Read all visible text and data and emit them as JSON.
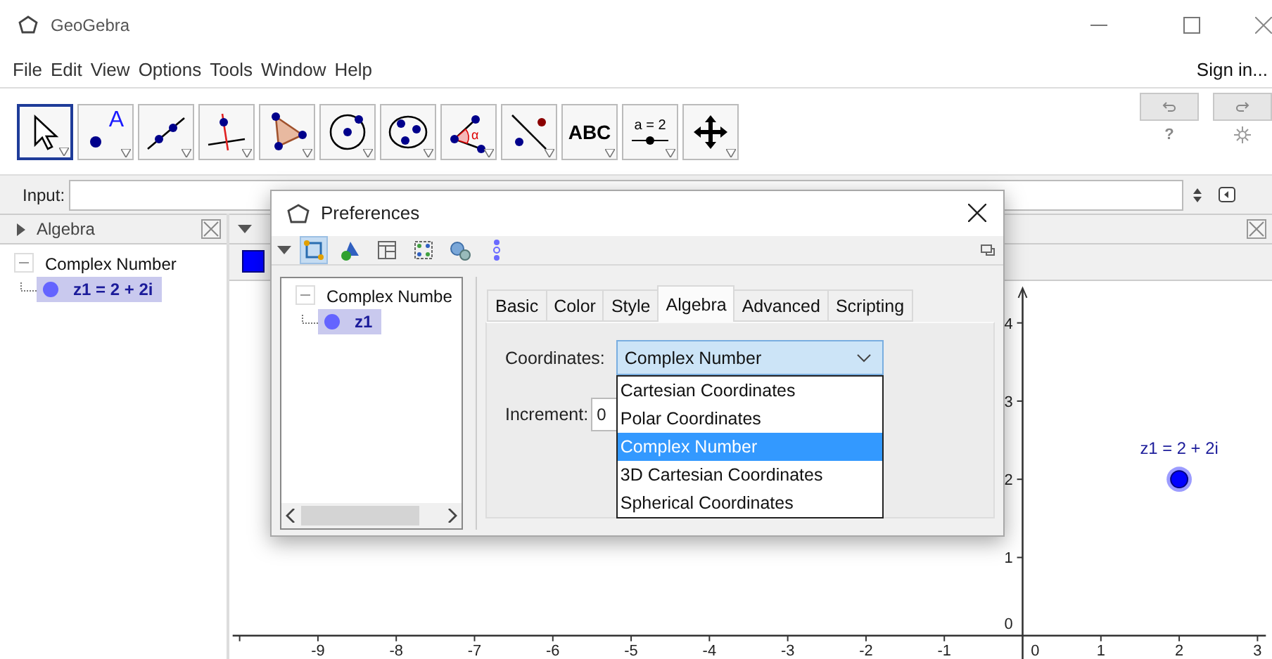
{
  "window": {
    "title": "GeoGebra",
    "sign_in": "Sign in..."
  },
  "menu": [
    "File",
    "Edit",
    "View",
    "Options",
    "Tools",
    "Window",
    "Help"
  ],
  "tools": [
    {
      "kind": "move",
      "selected": true
    },
    {
      "kind": "point",
      "label": "A",
      "selected": false
    },
    {
      "kind": "line",
      "selected": false
    },
    {
      "kind": "perpendicular",
      "selected": false
    },
    {
      "kind": "polygon",
      "selected": false
    },
    {
      "kind": "circle",
      "selected": false
    },
    {
      "kind": "conic",
      "selected": false
    },
    {
      "kind": "angle",
      "label": "α",
      "selected": false
    },
    {
      "kind": "reflect",
      "selected": false
    },
    {
      "kind": "text",
      "label": "ABC",
      "selected": false
    },
    {
      "kind": "slider",
      "label": "a = 2",
      "selected": false
    },
    {
      "kind": "pan",
      "selected": false
    }
  ],
  "help": "?",
  "input": {
    "label": "Input:"
  },
  "algebra": {
    "title": "Algebra",
    "tree": [
      {
        "label": "Complex Number",
        "expanded": true,
        "selected": false,
        "children": [
          {
            "label": "z1 = 2 + 2i",
            "selected": true
          }
        ]
      }
    ]
  },
  "graphics": {
    "x_labels": [
      "-9",
      "-8",
      "-7",
      "-6",
      "-5",
      "-4",
      "-3",
      "-2",
      "-1",
      "0",
      "1",
      "2",
      "3"
    ],
    "y_labels": [
      "4",
      "3",
      "2",
      "1",
      "0"
    ],
    "point": {
      "label": "z1 = 2 + 2i"
    }
  },
  "preferences": {
    "title": "Preferences",
    "views": [
      {
        "kind": "graphics",
        "selected": true
      },
      {
        "kind": "objects",
        "selected": false
      },
      {
        "kind": "layout",
        "selected": false
      },
      {
        "kind": "defaults",
        "selected": false
      },
      {
        "kind": "advanced",
        "selected": false
      },
      {
        "kind": "more",
        "selected": false
      }
    ],
    "tree": [
      {
        "label": "Complex Numbe",
        "expanded": true,
        "selected": false,
        "children": [
          {
            "label": "z1",
            "selected": true
          }
        ]
      }
    ],
    "tabs": [
      {
        "label": "Basic",
        "selected": false
      },
      {
        "label": "Color",
        "selected": false
      },
      {
        "label": "Style",
        "selected": false
      },
      {
        "label": "Algebra",
        "selected": true
      },
      {
        "label": "Advanced",
        "selected": false
      },
      {
        "label": "Scripting",
        "selected": false
      }
    ],
    "coordinates": {
      "label": "Coordinates:",
      "value": "Complex Number",
      "open": true,
      "options": [
        {
          "label": "Cartesian Coordinates",
          "selected": false
        },
        {
          "label": "Polar Coordinates",
          "selected": false
        },
        {
          "label": "Complex Number",
          "selected": true
        },
        {
          "label": "3D Cartesian Coordinates",
          "selected": false
        },
        {
          "label": "Spherical Coordinates",
          "selected": false
        }
      ]
    },
    "increment": {
      "label": "Increment:",
      "value": "0"
    }
  }
}
